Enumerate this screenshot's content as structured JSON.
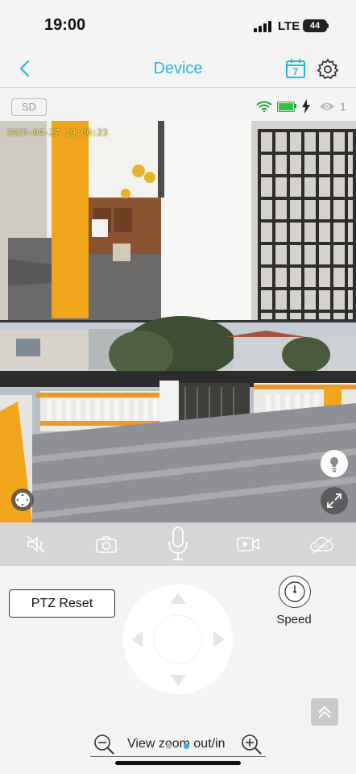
{
  "status_bar": {
    "time": "19:00",
    "network": "LTE",
    "battery": "44"
  },
  "nav": {
    "title": "Device",
    "calendar_day": "7"
  },
  "info_row": {
    "storage_badge": "SD",
    "viewer_count": "1"
  },
  "video": {
    "timestamp": "2025-04-27 19:00:23"
  },
  "toolbar": {
    "items": [
      {
        "icon": "speaker-muted-icon"
      },
      {
        "icon": "camera-icon"
      },
      {
        "icon": "microphone-icon"
      },
      {
        "icon": "video-record-icon"
      },
      {
        "icon": "cloud-off-icon",
        "label": "Cloud"
      }
    ]
  },
  "controls": {
    "ptz_reset_label": "PTZ Reset",
    "speed_label": "Speed",
    "zoom_label": "View zoom out/in"
  },
  "colors": {
    "accent": "#2bb5d8",
    "toolbar_bg": "#d6d6d6",
    "background": "#f4f4f4"
  }
}
